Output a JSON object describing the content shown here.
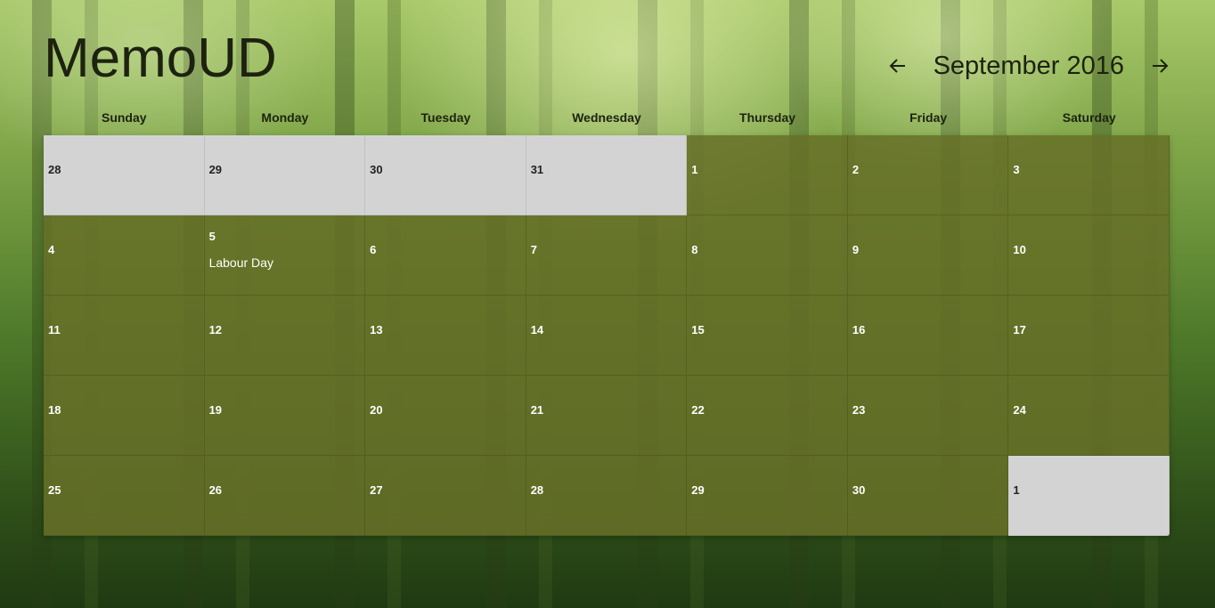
{
  "app": {
    "title": "MemoUD"
  },
  "nav": {
    "month_label": "September 2016",
    "prev_icon": "arrow-left-icon",
    "next_icon": "arrow-right-icon"
  },
  "weekdays": [
    "Sunday",
    "Monday",
    "Tuesday",
    "Wednesday",
    "Thursday",
    "Friday",
    "Saturday"
  ],
  "colors": {
    "current_month_cell": "#667028",
    "other_month_cell": "#d3d3d3",
    "text_dark": "#1d2210",
    "text_light": "#ffffff"
  },
  "days": [
    {
      "day": "28",
      "other": true
    },
    {
      "day": "29",
      "other": true
    },
    {
      "day": "30",
      "other": true
    },
    {
      "day": "31",
      "other": true
    },
    {
      "day": "1"
    },
    {
      "day": "2"
    },
    {
      "day": "3"
    },
    {
      "day": "4"
    },
    {
      "day": "5",
      "event": "Labour Day"
    },
    {
      "day": "6"
    },
    {
      "day": "7"
    },
    {
      "day": "8"
    },
    {
      "day": "9"
    },
    {
      "day": "10"
    },
    {
      "day": "11"
    },
    {
      "day": "12"
    },
    {
      "day": "13"
    },
    {
      "day": "14"
    },
    {
      "day": "15"
    },
    {
      "day": "16"
    },
    {
      "day": "17"
    },
    {
      "day": "18"
    },
    {
      "day": "19"
    },
    {
      "day": "20"
    },
    {
      "day": "21"
    },
    {
      "day": "22"
    },
    {
      "day": "23"
    },
    {
      "day": "24"
    },
    {
      "day": "25"
    },
    {
      "day": "26"
    },
    {
      "day": "27"
    },
    {
      "day": "28"
    },
    {
      "day": "29"
    },
    {
      "day": "30"
    },
    {
      "day": "1",
      "other": true
    }
  ]
}
